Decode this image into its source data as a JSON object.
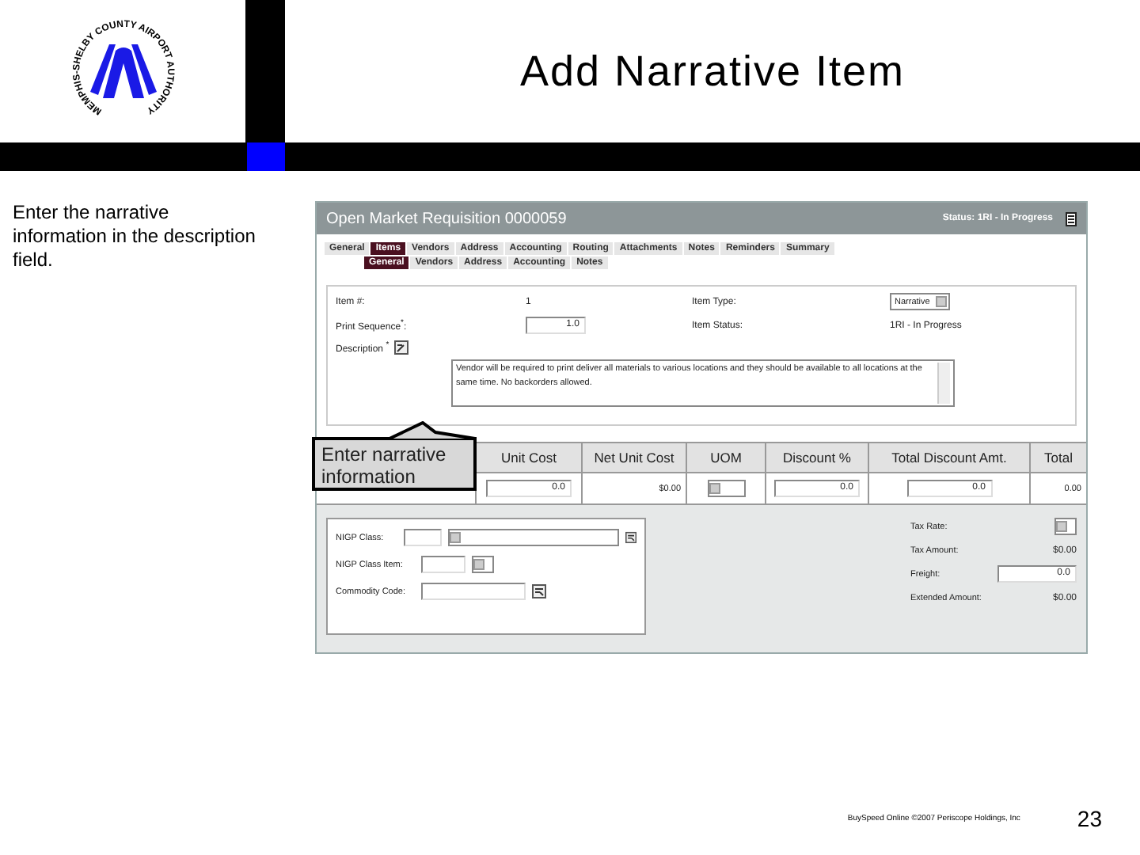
{
  "slide": {
    "logo_text": "MEMPHIS-SHELBY COUNTY AIRPORT AUTHORITY",
    "title": "Add Narrative Item",
    "instruction": "Enter the narrative information in the description field.",
    "footer": "BuySpeed Online ©2007  Periscope Holdings, Inc",
    "page_number": "23"
  },
  "app": {
    "title": "Open Market Requisition 0000059",
    "status": "Status: 1RI - In Progress",
    "tabs": [
      {
        "label": "General",
        "selected": false
      },
      {
        "label": "Items",
        "selected": true
      },
      {
        "label": "Vendors",
        "selected": false
      },
      {
        "label": "Address",
        "selected": false
      },
      {
        "label": "Accounting",
        "selected": false
      },
      {
        "label": "Routing",
        "selected": false
      },
      {
        "label": "Attachments",
        "selected": false
      },
      {
        "label": "Notes",
        "selected": false
      },
      {
        "label": "Reminders",
        "selected": false
      },
      {
        "label": "Summary",
        "selected": false
      }
    ],
    "subtabs": [
      {
        "label": "General",
        "selected": true
      },
      {
        "label": "Vendors",
        "selected": false
      },
      {
        "label": "Address",
        "selected": false
      },
      {
        "label": "Accounting",
        "selected": false
      },
      {
        "label": "Notes",
        "selected": false
      }
    ],
    "form": {
      "item_number_label": "Item #:",
      "item_number": "1",
      "print_sequence_label": "Print Sequence$^{*}$:",
      "print_sequence": "1.0",
      "description_label": "Description $^{*}$",
      "description": "Vendor will be required to print deliver all materials to various locations and they should be available to all locations at the same time.  No backorders allowed.",
      "item_type_label": "Item Type:",
      "item_type": "Narrative",
      "item_status_label": "Item Status:",
      "item_status": "1RI - In Progress"
    },
    "table": {
      "columns": [
        "",
        "Unit Cost",
        "Net Unit Cost",
        "UOM",
        "Discount %",
        "Total Discount Amt.",
        "Total"
      ],
      "row": [
        {
          "kind": "blank"
        },
        {
          "kind": "input",
          "value": "0.0"
        },
        {
          "kind": "text",
          "value": "$0.00"
        },
        {
          "kind": "select"
        },
        {
          "kind": "input",
          "value": "0.0"
        },
        {
          "kind": "input",
          "value": "0.0"
        },
        {
          "kind": "text",
          "value": "0.00"
        }
      ]
    },
    "classification": [
      {
        "label": "NIGP Class:",
        "kind": "class"
      },
      {
        "label": "NIGP Class Item:",
        "kind": "item"
      },
      {
        "label": "Commodity Code:",
        "kind": "code"
      }
    ],
    "totals": [
      {
        "label": "Tax Rate:",
        "kind": "select"
      },
      {
        "label": "Tax Amount:",
        "kind": "text",
        "value": "$0.00"
      },
      {
        "label": "Freight:",
        "kind": "input",
        "value": "0.0"
      },
      {
        "label": "Extended Amount:",
        "kind": "text",
        "value": "$0.00"
      }
    ],
    "callout": "Enter narrative information"
  }
}
